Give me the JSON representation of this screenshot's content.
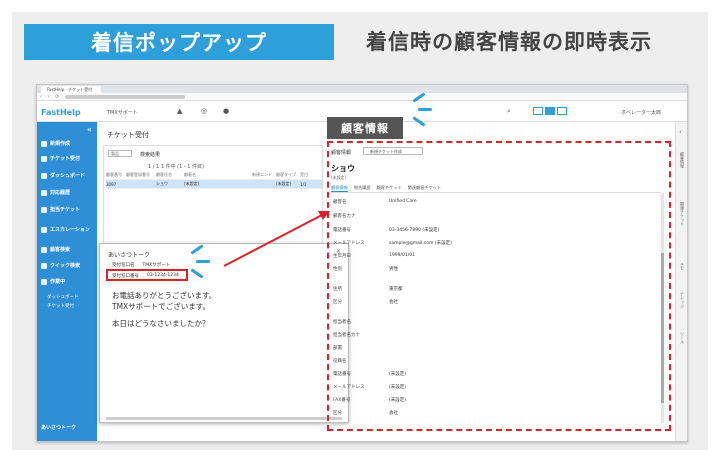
{
  "banner": {
    "title": "着信ポップアップ",
    "headline": "着信時の顧客情報の即時表示"
  },
  "browser": {
    "tab_label": "FastHelp - チケット受付"
  },
  "app": {
    "logo": "FastHelp",
    "org_selector": "TMXサポート",
    "user": "オペレーター太郎"
  },
  "sidebar": {
    "items": [
      {
        "label": "新規作成"
      },
      {
        "label": "チケット受付"
      },
      {
        "label": "ダッシュボード"
      },
      {
        "label": "対応履歴"
      },
      {
        "label": "担当チケット"
      },
      {
        "label": "エスカレーション"
      },
      {
        "label": "顧客検索"
      },
      {
        "label": "クイック検索"
      },
      {
        "label": "作業中"
      }
    ],
    "sub_items": [
      "ダッシュボード",
      "チケット受付"
    ],
    "bottom": "あいさつトーク"
  },
  "ticket": {
    "title": "チケット受付",
    "filter": "製品",
    "result_label": "検索結果",
    "pager": "1 / 1  1 件中 (1 - 1 件目)",
    "columns": [
      "顧客番号",
      "顧客登録番号",
      "顧客氏名",
      "顧客名",
      "",
      "新規エンド",
      "顧客タイプ",
      "受付"
    ],
    "row": [
      "3097",
      "",
      "ショウ",
      "(未設定)",
      "",
      "",
      "(未設定)",
      "1/1"
    ]
  },
  "popup": {
    "title": "あいさつトーク",
    "close": "✕",
    "line1_label": "受付窓口名",
    "line1_value": "TMXサポート",
    "line2_label": "受付窓口番号",
    "line2_value": "03-1234-1234",
    "message1": "お電話ありがとうございます。",
    "message2": "TMXサポートでございます。",
    "message3": "本日はどうなさいましたか？"
  },
  "customer": {
    "label": "顧客情報",
    "section_title": "顧客情報",
    "dropdown": "新規チケット作成",
    "name": "ショウ",
    "status": "(未設定)",
    "tabs": [
      "顧客情報",
      "問合履歴",
      "顧客チケット",
      "関連顧客チケット"
    ],
    "fields": [
      {
        "label": "顧客名",
        "value": "Unified Care"
      },
      {
        "label": "顧客名カナ",
        "value": ""
      },
      {
        "label": "電話番号",
        "value": "03-3456-7890  (未設定)"
      },
      {
        "label": "メールアドレス",
        "value": "sample@gmail.com  (未設定)"
      },
      {
        "label": "生年月日",
        "value": "1999/01/01"
      },
      {
        "label": "性別",
        "value": "男性"
      },
      {
        "label": "住所",
        "value": "東京都"
      },
      {
        "label": "区分",
        "value": "会社"
      },
      {
        "label": "担当者名",
        "value": ""
      },
      {
        "label": "担当者名カナ",
        "value": ""
      },
      {
        "label": "部署",
        "value": ""
      },
      {
        "label": "役職名",
        "value": ""
      },
      {
        "label": "電話番号",
        "value": "(未設定)"
      },
      {
        "label": "メールアドレス",
        "value": "(未設定)"
      },
      {
        "label": "FAX番号",
        "value": "(未設定)"
      },
      {
        "label": "区分",
        "value": "会社"
      }
    ]
  },
  "right_rail": [
    "顧客情報",
    "関連チケット",
    "メモ",
    "ナレッジ",
    "ツール"
  ],
  "colors": {
    "accent": "#2e9fd8",
    "highlight": "#d8232a",
    "sidebar": "#2e8fd6"
  }
}
